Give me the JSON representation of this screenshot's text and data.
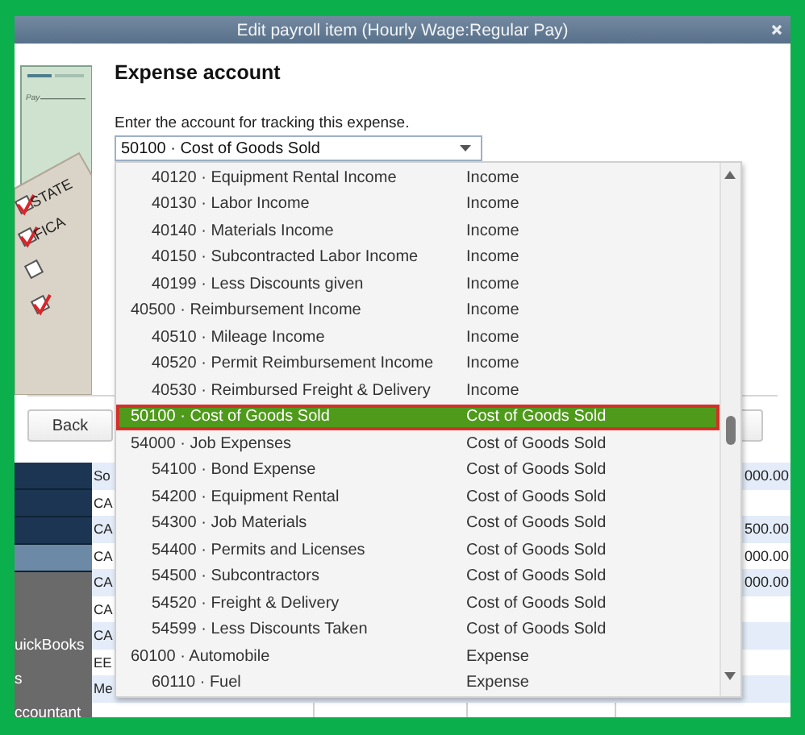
{
  "window": {
    "title": "Edit payroll item (Hourly Wage:Regular Pay)"
  },
  "illustration": {
    "labels": [
      "Pay",
      "STATE",
      "FICA"
    ]
  },
  "heading": "Expense account",
  "prompt": "Enter the account for tracking this expense.",
  "account_field": {
    "value": "50100 · Cost of Goods Sold"
  },
  "account_list": [
    {
      "children": [
        {
          "name": "40120 · Equipment Rental Income",
          "type": "Income",
          "selected": false
        },
        {
          "name": "40130 · Labor Income",
          "type": "Income",
          "selected": false
        },
        {
          "name": "40140 · Materials Income",
          "type": "Income",
          "selected": false
        },
        {
          "name": "40150 · Subcontracted Labor Income",
          "type": "Income",
          "selected": false
        },
        {
          "name": "40199 · Less Discounts given",
          "type": "Income",
          "selected": false
        }
      ]
    },
    {
      "name": "40500 · Reimbursement Income",
      "type": "Income",
      "selected": false,
      "children": [
        {
          "name": "40510 · Mileage Income",
          "type": "Income",
          "selected": false
        },
        {
          "name": "40520 · Permit Reimbursement Income",
          "type": "Income",
          "selected": false
        },
        {
          "name": "40530 · Reimbursed Freight & Delivery",
          "type": "Income",
          "selected": false
        }
      ]
    },
    {
      "name": "50100 · Cost of Goods Sold",
      "type": "Cost of Goods Sold",
      "selected": true
    },
    {
      "name": "54000 · Job Expenses",
      "type": "Cost of Goods Sold",
      "selected": false,
      "children": [
        {
          "name": "54100 · Bond Expense",
          "type": "Cost of Goods Sold",
          "selected": false
        },
        {
          "name": "54200 · Equipment Rental",
          "type": "Cost of Goods Sold",
          "selected": false
        },
        {
          "name": "54300 · Job Materials",
          "type": "Cost of Goods Sold",
          "selected": false
        },
        {
          "name": "54400 · Permits and Licenses",
          "type": "Cost of Goods Sold",
          "selected": false
        },
        {
          "name": "54500 · Subcontractors",
          "type": "Cost of Goods Sold",
          "selected": false
        },
        {
          "name": "54520 · Freight & Delivery",
          "type": "Cost of Goods Sold",
          "selected": false
        },
        {
          "name": "54599 · Less Discounts Taken",
          "type": "Cost of Goods Sold",
          "selected": false
        }
      ]
    },
    {
      "name": "60100 · Automobile",
      "type": "Expense",
      "selected": false,
      "children": [
        {
          "name": "60110 · Fuel",
          "type": "Expense",
          "selected": false
        }
      ]
    }
  ],
  "back_button": "Back",
  "sidebar": {
    "items": [
      {
        "selected": false
      },
      {
        "selected": false
      },
      {
        "selected": false
      },
      {
        "selected": true
      }
    ],
    "labels": [
      "uickBooks",
      "s",
      "ccountant"
    ]
  },
  "table": {
    "rows": [
      {
        "column_1": "So",
        "amount": "000.00"
      },
      {
        "column_1": "CA"
      },
      {
        "column_1": "CA",
        "amount": "500.00"
      },
      {
        "column_1": "CA",
        "amount": "000.00"
      },
      {
        "column_1": "CA",
        "amount": "000.00"
      },
      {
        "column_1": "CA"
      },
      {
        "column_1": "CA"
      },
      {
        "column_1": "EE"
      },
      {
        "column_1": "Me"
      }
    ]
  }
}
